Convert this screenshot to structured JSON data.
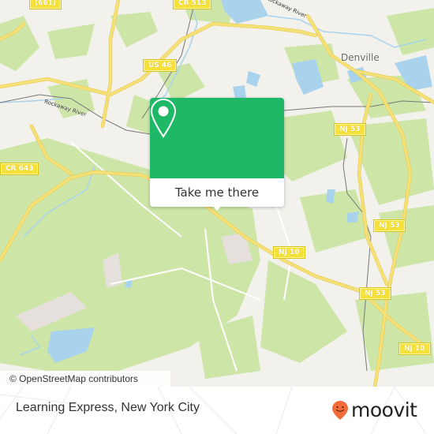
{
  "map": {
    "attribution": "© OpenStreetMap contributors",
    "place_labels": [
      {
        "name": "Denville"
      }
    ],
    "river_labels": [
      {
        "name": "Rockaway River"
      },
      {
        "name": "Rockaway River"
      }
    ],
    "road_shields": [
      {
        "label": "(661)"
      },
      {
        "label": "CR 513"
      },
      {
        "label": "US 46"
      },
      {
        "label": "CR 643"
      },
      {
        "label": "NJ 53"
      },
      {
        "label": "NJ 53"
      },
      {
        "label": "NJ 10"
      },
      {
        "label": "NJ 53"
      },
      {
        "label": "NJ 10"
      }
    ],
    "colors": {
      "background": "#f2f1ec",
      "forest": "#cde6a8",
      "water": "#a9d3ec",
      "road": "#f6e07a",
      "rail": "#777777",
      "residential": "#e6e0dc"
    }
  },
  "popup": {
    "action_label": "Take me there",
    "icon": "map-pin-icon",
    "color": "#1fb867"
  },
  "footer": {
    "title": "Learning Express, New York City",
    "brand": "moovit",
    "brand_icon": "moovit-smiley-pin-icon",
    "brand_color": "#f26b3a"
  }
}
